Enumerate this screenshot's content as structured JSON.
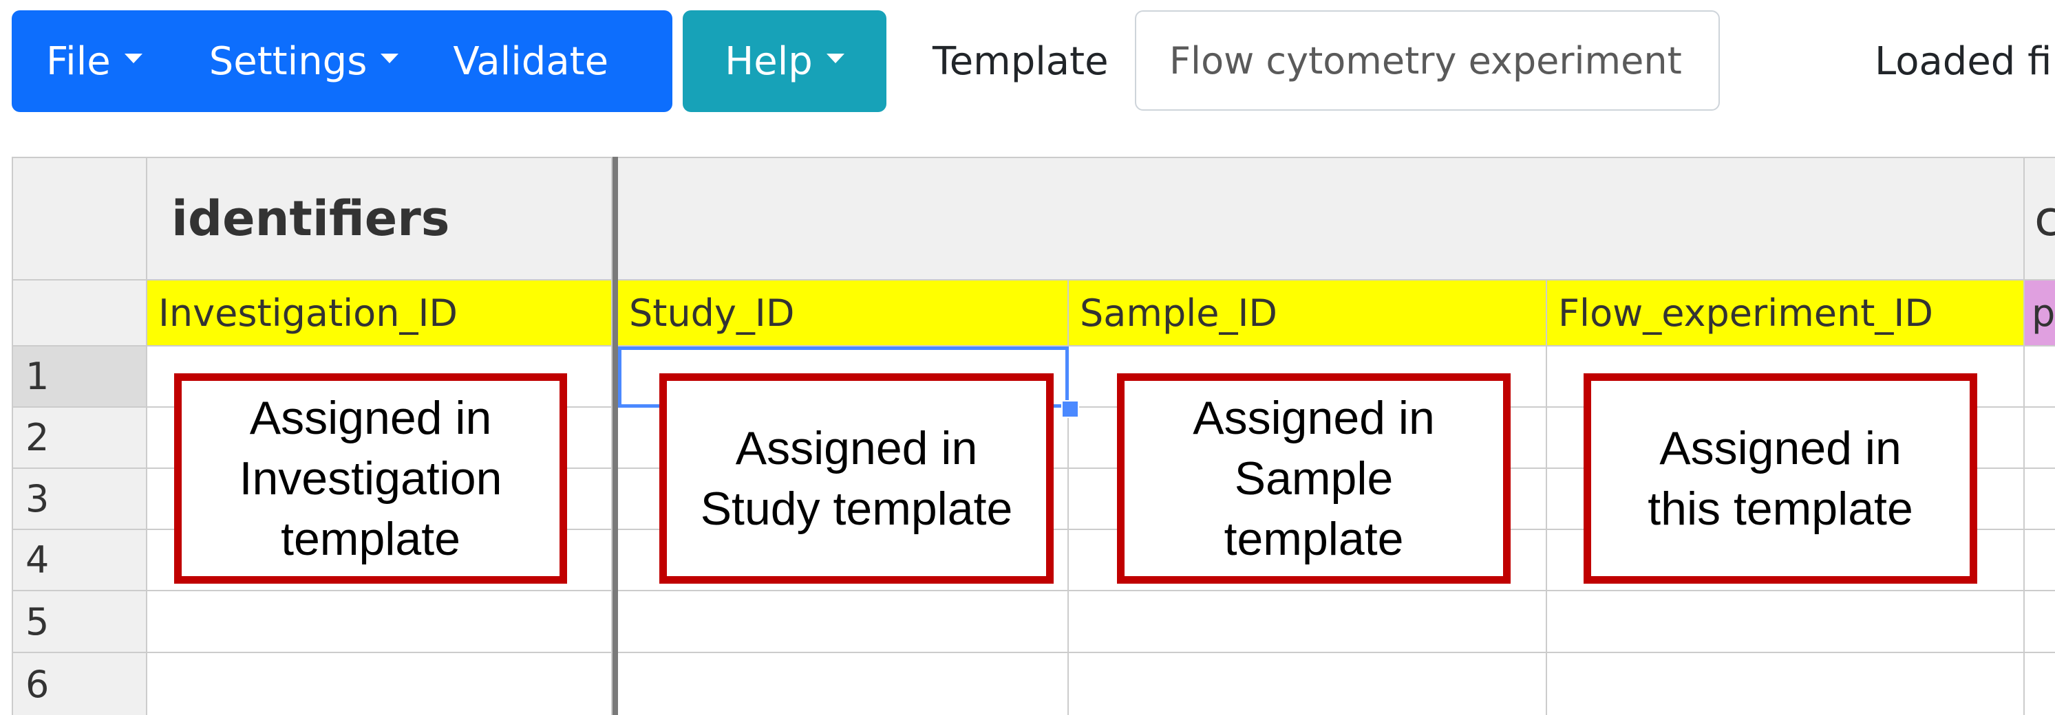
{
  "toolbar": {
    "file_label": "File",
    "settings_label": "Settings",
    "validate_label": "Validate",
    "help_label": "Help",
    "template_label": "Template",
    "template_value": "Flow cytometry experiment",
    "loaded_file_label": "Loaded fil"
  },
  "grid": {
    "group_title": "identifiers",
    "group_title_next": "c",
    "columns": [
      "Investigation_ID",
      "Study_ID",
      "Sample_ID",
      "Flow_experiment_ID",
      "p"
    ],
    "rows": [
      "1",
      "2",
      "3",
      "4",
      "5",
      "6"
    ]
  },
  "callouts": [
    {
      "text": "Assigned in\nInvestigation\ntemplate"
    },
    {
      "text": "Assigned in\nStudy template"
    },
    {
      "text": "Assigned in\nSample\ntemplate"
    },
    {
      "text": "Assigned in\nthis template"
    }
  ],
  "colors": {
    "primary": "#0d6efd",
    "help": "#17a2b8",
    "id_header": "#ffff00",
    "next_header": "#e0a0e0",
    "callout_border": "#c00000",
    "selection": "#4b89ff"
  }
}
